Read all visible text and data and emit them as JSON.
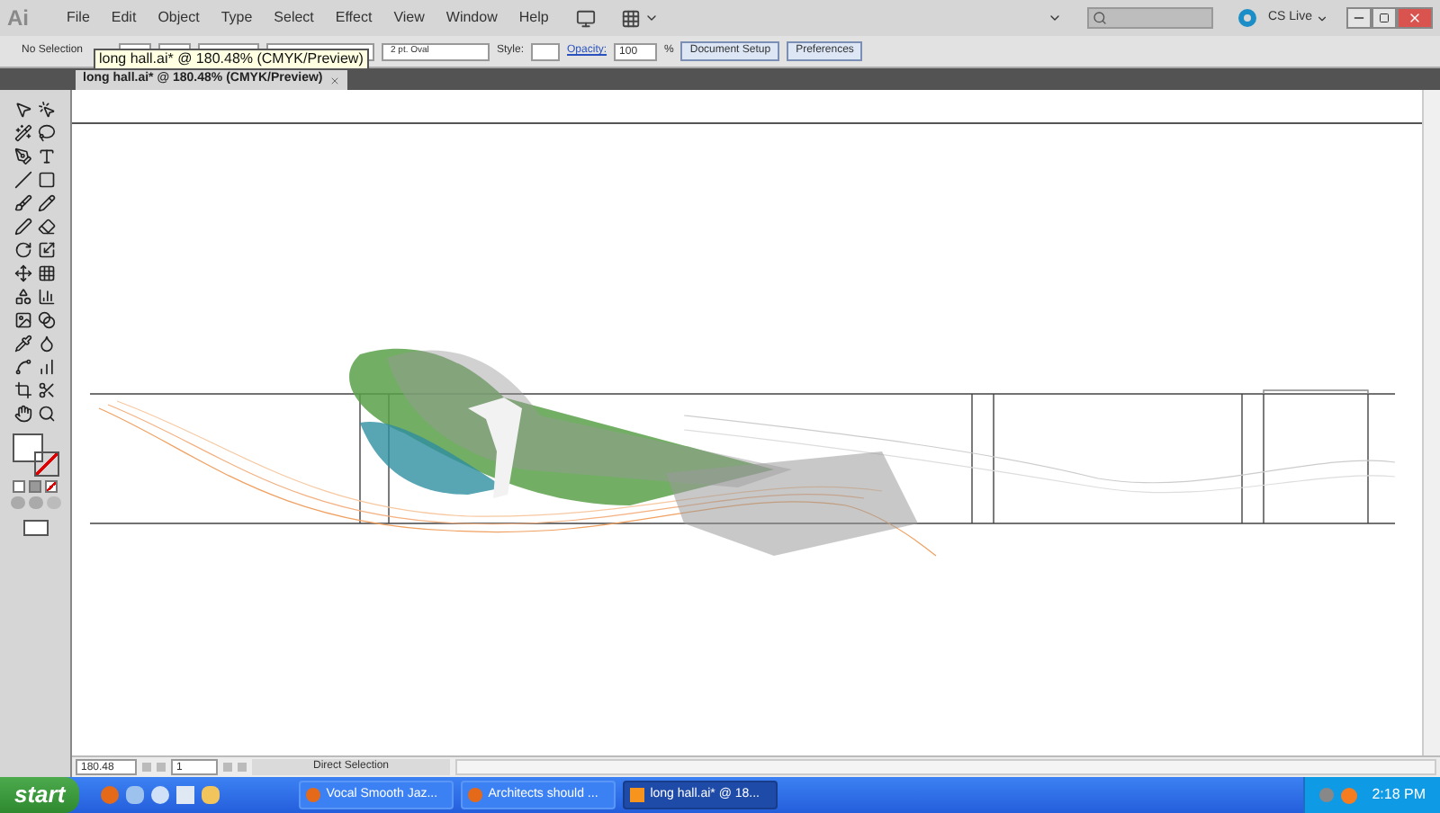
{
  "app_logo": "Ai",
  "menu": [
    "File",
    "Edit",
    "Object",
    "Type",
    "Select",
    "Effect",
    "View",
    "Window",
    "Help"
  ],
  "cs_live": "CS Live",
  "control_bar": {
    "selection_label": "No Selection",
    "brush": "2 pt. Oval",
    "style_label": "Style:",
    "opacity_label": "Opacity:",
    "opacity_value": "100",
    "percent": "%",
    "buttons": [
      "Document Setup",
      "Preferences"
    ]
  },
  "document_tab": {
    "title": "long hall.ai* @ 180.48% (CMYK/Preview)"
  },
  "tooltip": "long hall.ai* @ 180.48% (CMYK/Preview)",
  "status_bar": {
    "zoom": "180.48",
    "page": "1",
    "tool": "Direct Selection"
  },
  "taskbar": {
    "start": "start",
    "tasks": [
      {
        "label": "Vocal Smooth Jaz...",
        "selected": false
      },
      {
        "label": "Architects should ...",
        "selected": false
      },
      {
        "label": "long hall.ai* @ 18...",
        "selected": true
      }
    ],
    "clock": "2:18 PM"
  }
}
